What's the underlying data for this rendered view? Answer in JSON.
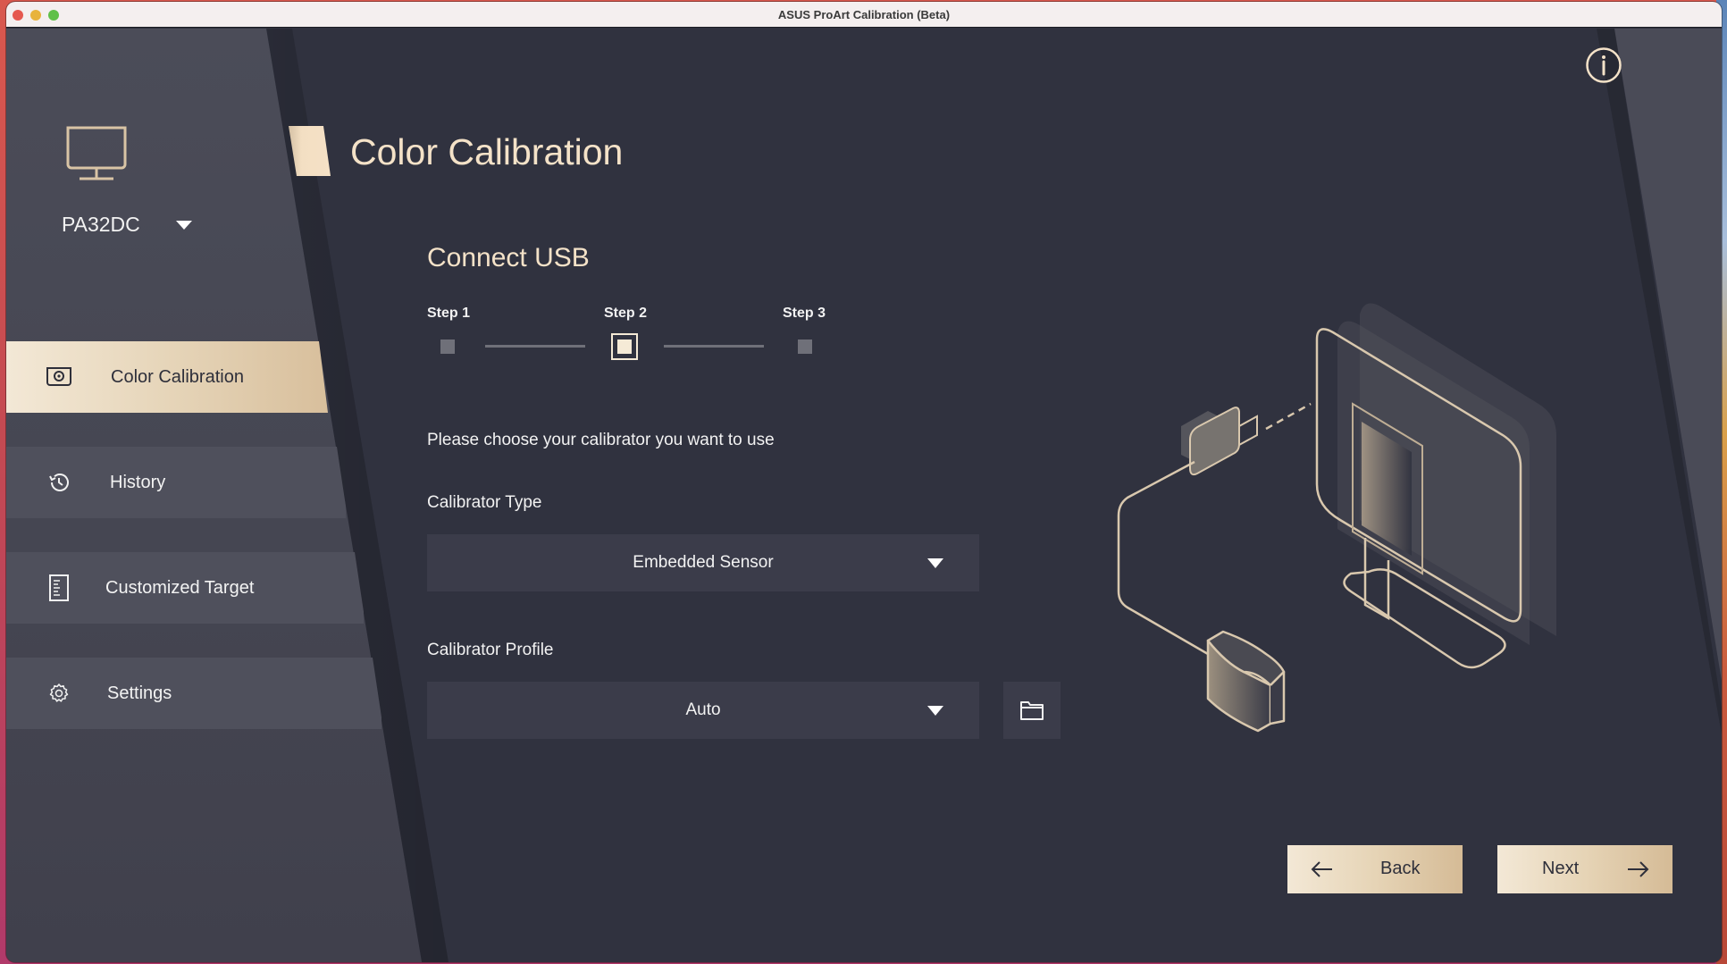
{
  "window": {
    "title": "ASUS ProArt Calibration (Beta)"
  },
  "sidebar": {
    "device_icon": "monitor-icon",
    "device_name": "PA32DC",
    "device_dropdown_icon": "caret-down-icon",
    "items": [
      {
        "label": "Color Calibration",
        "icon": "calibration-device-icon",
        "active": true
      },
      {
        "label": "History",
        "icon": "history-icon",
        "active": false
      },
      {
        "label": "Customized Target",
        "icon": "document-icon",
        "active": false
      },
      {
        "label": "Settings",
        "icon": "gear-icon",
        "active": false
      }
    ]
  },
  "header": {
    "title": "Color Calibration",
    "info_icon": "info-icon"
  },
  "main": {
    "section_title": "Connect USB",
    "steps": [
      {
        "label": "Step 1",
        "state": "pending"
      },
      {
        "label": "Step 2",
        "state": "current"
      },
      {
        "label": "Step 3",
        "state": "pending"
      }
    ],
    "current_step": 2,
    "total_steps": 3,
    "prompt": "Please choose your calibrator you want to use",
    "calibrator_type": {
      "label": "Calibrator Type",
      "value": "Embedded Sensor"
    },
    "calibrator_profile": {
      "label": "Calibrator Profile",
      "value": "Auto",
      "browse_icon": "folder-icon"
    },
    "illustration": "usb-calibrator-connected-to-monitor"
  },
  "footer": {
    "back_label": "Back",
    "back_icon": "arrow-left-icon",
    "next_label": "Next",
    "next_icon": "arrow-right-icon"
  },
  "colors": {
    "accent_text": "#f4e2c8",
    "accent_gold_start": "#f3e8d6",
    "accent_gold_end": "#d5bb96",
    "background": "#30323f",
    "sidebar": "#4b4c58",
    "field": "#3b3c4a"
  }
}
